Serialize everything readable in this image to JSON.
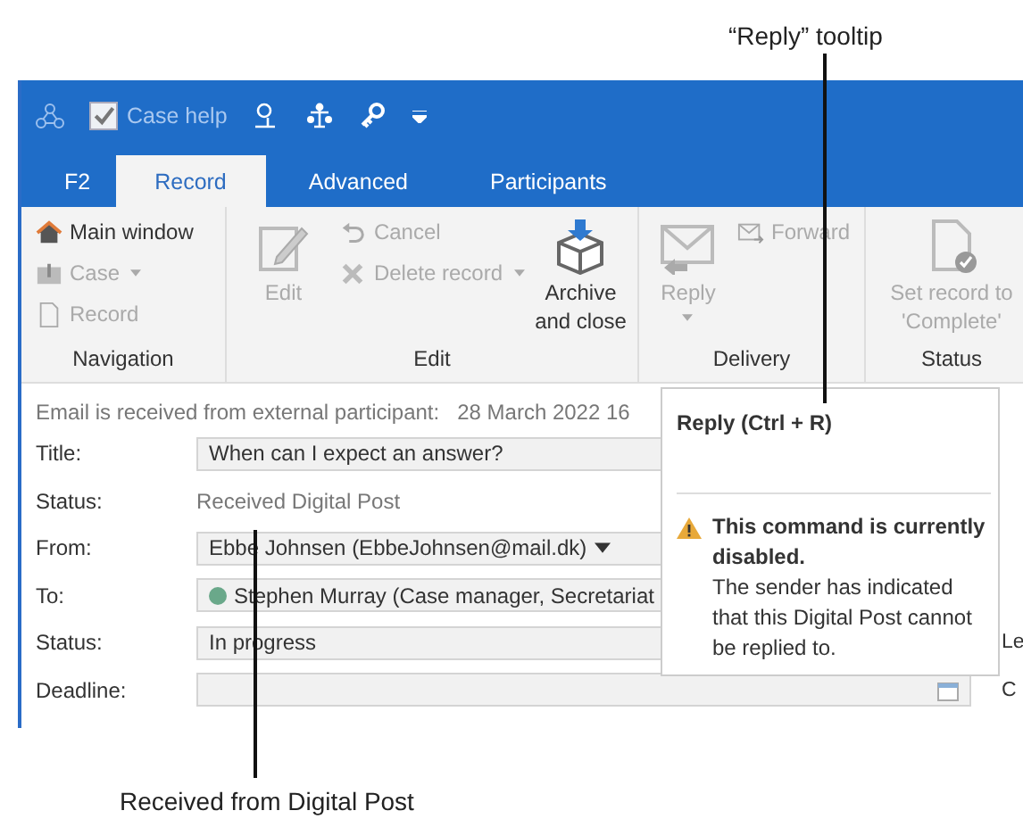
{
  "callouts": [
    {
      "text": "“Reply” tooltip"
    },
    {
      "text": "Received from Digital Post"
    }
  ],
  "quick_access": {
    "case_help": {
      "label": "Case help",
      "checked": true
    }
  },
  "tabs": [
    {
      "label": "F2",
      "selected": false
    },
    {
      "label": "Record",
      "selected": true
    },
    {
      "label": "Advanced",
      "selected": false
    },
    {
      "label": "Participants",
      "selected": false
    }
  ],
  "ribbon": {
    "groups": [
      {
        "label": "Navigation",
        "buttons": [
          {
            "label": "Main window",
            "kind": "small",
            "disabled": false,
            "dropdown": false
          },
          {
            "label": "Case",
            "kind": "small",
            "disabled": true,
            "dropdown": true
          },
          {
            "label": "Record",
            "kind": "small",
            "disabled": true,
            "dropdown": false
          }
        ]
      },
      {
        "label": "Edit",
        "buttons": [
          {
            "label": "Edit",
            "kind": "large",
            "disabled": true,
            "dropdown": false
          },
          {
            "label": "Cancel",
            "kind": "small",
            "disabled": true,
            "dropdown": false
          },
          {
            "label": "Delete record",
            "kind": "small",
            "disabled": true,
            "dropdown": true
          },
          {
            "label": "Archive and close",
            "kind": "large",
            "disabled": false,
            "dropdown": false
          }
        ]
      },
      {
        "label": "Delivery",
        "buttons": [
          {
            "label": "Reply",
            "kind": "large",
            "disabled": true,
            "dropdown": true
          },
          {
            "label": "Forward",
            "kind": "small",
            "disabled": true,
            "dropdown": false
          }
        ]
      },
      {
        "label": "Status",
        "buttons": [
          {
            "label": "Set record to 'Complete'",
            "kind": "large",
            "disabled": true,
            "dropdown": false
          }
        ]
      }
    ]
  },
  "form": {
    "info": {
      "label": "Email is received from external participant:",
      "value": "28 March 2022 16"
    },
    "rows": [
      {
        "label": "Title:",
        "kind": "text-field",
        "value": "When can I expect an answer?"
      },
      {
        "label": "Status:",
        "kind": "plain",
        "value": "Received Digital Post"
      },
      {
        "label": "From:",
        "kind": "dropdown",
        "value": "Ebbe Johnsen (EbbeJohnsen@mail.dk)"
      },
      {
        "label": "To:",
        "kind": "participant",
        "value": "Stephen Murray (Case manager, Secretariat",
        "color": "#6aa88a"
      },
      {
        "label": "Status:",
        "kind": "text-field",
        "value": "In progress",
        "side_label": "Le"
      },
      {
        "label": "Deadline:",
        "kind": "date",
        "side_label": "C"
      }
    ]
  },
  "tooltip": {
    "title": "Reply (Ctrl + R)",
    "warning": "This command is currently disabled.",
    "text": "The sender has indicated that this Digital Post cannot be replied to."
  }
}
